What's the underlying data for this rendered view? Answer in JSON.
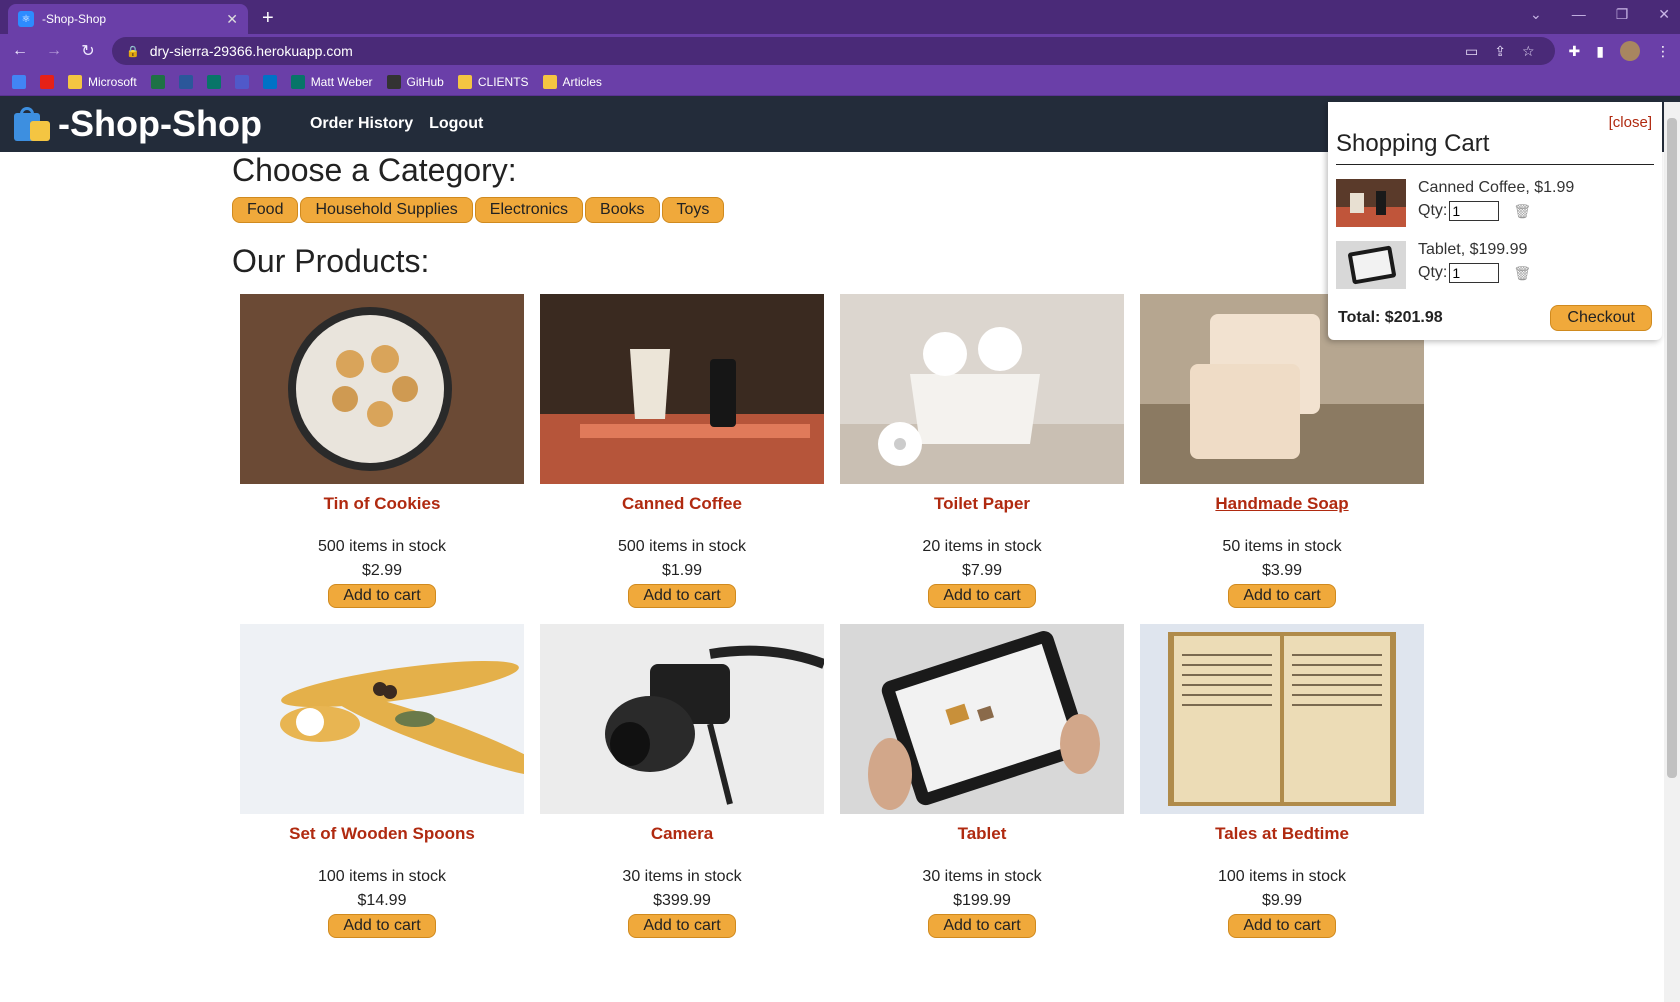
{
  "browser": {
    "tab_title": "-Shop-Shop",
    "url": "dry-sierra-29366.herokuapp.com",
    "bookmarks": [
      {
        "label": "",
        "color": "#4285f4"
      },
      {
        "label": "",
        "color": "#e62117"
      },
      {
        "label": "Microsoft",
        "color": "#f4c542"
      },
      {
        "label": "",
        "color": "#1e7145"
      },
      {
        "label": "",
        "color": "#2b579a"
      },
      {
        "label": "",
        "color": "#077568"
      },
      {
        "label": "",
        "color": "#5059c9"
      },
      {
        "label": "",
        "color": "#0072c6"
      },
      {
        "label": "Matt Weber",
        "color": "#077568"
      },
      {
        "label": "GitHub",
        "color": "#333333"
      },
      {
        "label": "CLIENTS",
        "color": "#f4c542"
      },
      {
        "label": "Articles",
        "color": "#f4c542"
      }
    ]
  },
  "header": {
    "logo_text": "-Shop-Shop",
    "nav": [
      "Order History",
      "Logout"
    ]
  },
  "categories": {
    "heading": "Choose a Category:",
    "items": [
      "Food",
      "Household Supplies",
      "Electronics",
      "Books",
      "Toys"
    ]
  },
  "products": {
    "heading": "Our Products:",
    "add_label": "Add to cart",
    "items": [
      {
        "name": "Tin of Cookies",
        "stock": "500 items in stock",
        "price": "$2.99",
        "bg": "#6b4a35"
      },
      {
        "name": "Canned Coffee",
        "stock": "500 items in stock",
        "price": "$1.99",
        "bg": "#5a3a2a"
      },
      {
        "name": "Toilet Paper",
        "stock": "20 items in stock",
        "price": "$7.99",
        "bg": "#d9d3cc"
      },
      {
        "name": "Handmade Soap",
        "stock": "50 items in stock",
        "price": "$3.99",
        "bg": "#c7b9a7"
      },
      {
        "name": "Set of Wooden Spoons",
        "stock": "100 items in stock",
        "price": "$14.99",
        "bg": "#eef1f5"
      },
      {
        "name": "Camera",
        "stock": "30 items in stock",
        "price": "$399.99",
        "bg": "#ececec"
      },
      {
        "name": "Tablet",
        "stock": "30 items in stock",
        "price": "$199.99",
        "bg": "#d8d8d8"
      },
      {
        "name": "Tales at Bedtime",
        "stock": "100 items in stock",
        "price": "$9.99",
        "bg": "#dfe5ee"
      }
    ]
  },
  "cart": {
    "close_label": "[close]",
    "title": "Shopping Cart",
    "qty_label": "Qty:",
    "items": [
      {
        "title": "Canned Coffee, $1.99",
        "qty": "1"
      },
      {
        "title": "Tablet, $199.99",
        "qty": "1"
      }
    ],
    "total": "Total: $201.98",
    "checkout_label": "Checkout"
  }
}
